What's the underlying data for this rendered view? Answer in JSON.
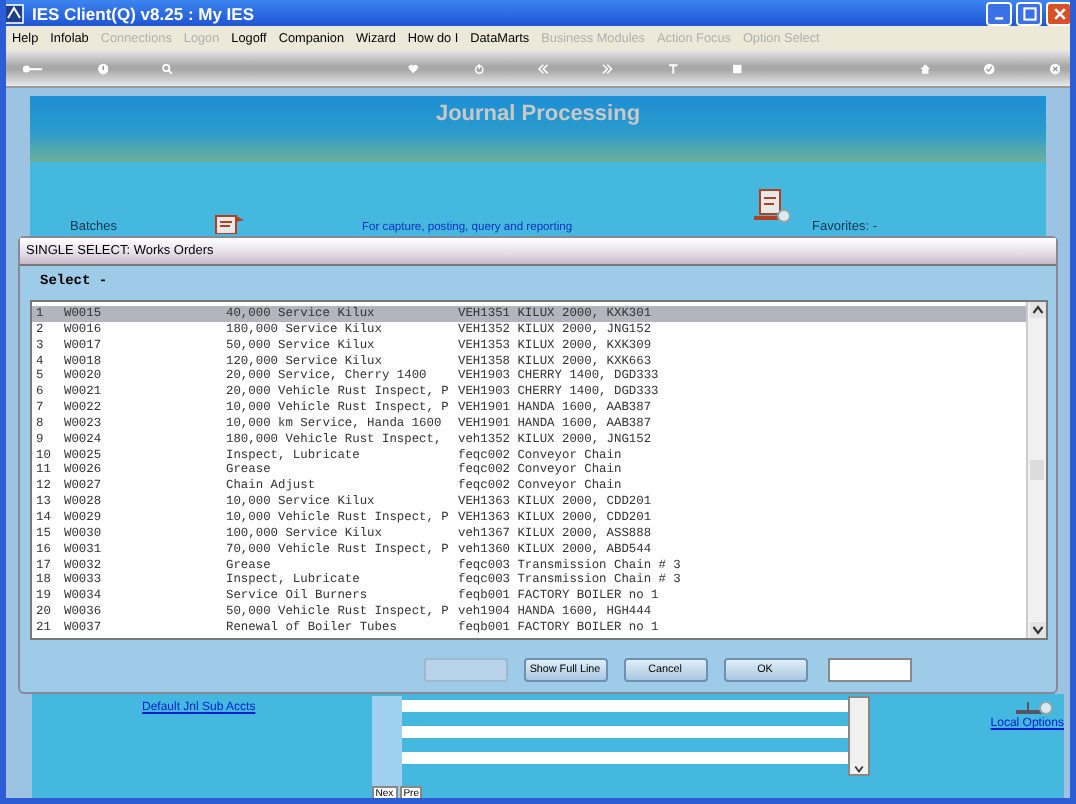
{
  "window": {
    "title": "IES Client(Q) v8.25 : My IES"
  },
  "menu": [
    {
      "label": "Help",
      "disabled": false
    },
    {
      "label": "Infolab",
      "disabled": false
    },
    {
      "label": "Connections",
      "disabled": true
    },
    {
      "label": "Logon",
      "disabled": true
    },
    {
      "label": "Logoff",
      "disabled": false
    },
    {
      "label": "Companion",
      "disabled": false
    },
    {
      "label": "Wizard",
      "disabled": false
    },
    {
      "label": "How do I",
      "disabled": false
    },
    {
      "label": "DataMarts",
      "disabled": false
    },
    {
      "label": "Business Modules",
      "disabled": true
    },
    {
      "label": "Action Focus",
      "disabled": true
    },
    {
      "label": "Option Select",
      "disabled": true
    }
  ],
  "header": {
    "title": "Journal Processing",
    "batches": "Batches",
    "subtitle": "For capture, posting, query and reporting",
    "favorites": "Favorites: -"
  },
  "dialog": {
    "title": "SINGLE SELECT: Works Orders",
    "select_label": "Select -",
    "rows": [
      {
        "number": "1",
        "code": "W0015",
        "description": "40,000 Service Kilux",
        "column_4": "VEH1351 KILUX 2000, KXK301",
        "selected": true
      },
      {
        "number": "2",
        "code": "W0016",
        "description": "180,000 Service Kilux",
        "column_4": "VEH1352 KILUX 2000, JNG152",
        "selected": false
      },
      {
        "number": "3",
        "code": "W0017",
        "description": "50,000 Service Kilux",
        "column_4": "VEH1353 KILUX 2000, KXK309",
        "selected": false
      },
      {
        "number": "4",
        "code": "W0018",
        "description": "120,000 Service Kilux",
        "column_4": "VEH1358 KILUX 2000, KXK663",
        "selected": false
      },
      {
        "number": "5",
        "code": "W0020",
        "description": "20,000 Service, Cherry 1400",
        "column_4": "VEH1903 CHERRY 1400, DGD333",
        "selected": false
      },
      {
        "number": "6",
        "code": "W0021",
        "description": "20,000 Vehicle Rust Inspect, P",
        "column_4": "VEH1903 CHERRY 1400, DGD333",
        "selected": false
      },
      {
        "number": "7",
        "code": "W0022",
        "description": "10,000 Vehicle Rust Inspect, P",
        "column_4": "VEH1901 HANDA 1600, AAB387",
        "selected": false
      },
      {
        "number": "8",
        "code": "W0023",
        "description": "10,000 km Service, Handa 1600",
        "column_4": "VEH1901 HANDA 1600, AAB387",
        "selected": false
      },
      {
        "number": "9",
        "code": "W0024",
        "description": "180,000 Vehicle Rust Inspect,",
        "column_4": "veh1352 KILUX 2000, JNG152",
        "selected": false
      },
      {
        "number": "10",
        "code": "W0025",
        "description": "Inspect, Lubricate",
        "column_4": "feqc002 Conveyor Chain",
        "selected": false
      },
      {
        "number": "11",
        "code": "W0026",
        "description": "Grease",
        "column_4": "feqc002 Conveyor Chain",
        "selected": false
      },
      {
        "number": "12",
        "code": "W0027",
        "description": "Chain Adjust",
        "column_4": "feqc002 Conveyor Chain",
        "selected": false
      },
      {
        "number": "13",
        "code": "W0028",
        "description": "10,000 Service Kilux",
        "column_4": "VEH1363 KILUX 2000, CDD201",
        "selected": false
      },
      {
        "number": "14",
        "code": "W0029",
        "description": "10,000 Vehicle Rust Inspect, P",
        "column_4": "VEH1363 KILUX 2000, CDD201",
        "selected": false
      },
      {
        "number": "15",
        "code": "W0030",
        "description": "100,000 Service Kilux",
        "column_4": "veh1367 KILUX 2000, ASS888",
        "selected": false
      },
      {
        "number": "16",
        "code": "W0031",
        "description": "70,000 Vehicle Rust Inspect, P",
        "column_4": "veh1360 KILUX 2000, ABD544",
        "selected": false
      },
      {
        "number": "17",
        "code": "W0032",
        "description": "Grease",
        "column_4": "feqc003 Transmission Chain # 3",
        "selected": false
      },
      {
        "number": "18",
        "code": "W0033",
        "description": "Inspect, Lubricate",
        "column_4": "feqc003 Transmission Chain # 3",
        "selected": false
      },
      {
        "number": "19",
        "code": "W0034",
        "description": "Service Oil Burners",
        "column_4": "feqb001 FACTORY BOILER no 1",
        "selected": false
      },
      {
        "number": "20",
        "code": "W0036",
        "description": "50,000 Vehicle Rust Inspect, P",
        "column_4": "veh1904 HANDA 1600, HGH444",
        "selected": false
      },
      {
        "number": "21",
        "code": "W0037",
        "description": "Renewal of Boiler Tubes",
        "column_4": "feqb001 FACTORY BOILER no 1",
        "selected": false
      }
    ],
    "buttons": [
      {
        "disabled": true
      },
      {
        "label": "Show Full Line",
        "disabled": false
      },
      {
        "label": "Cancel",
        "disabled": false
      },
      {
        "label": "OK",
        "disabled": false
      }
    ]
  },
  "bottom": {
    "link": "Default Jnl Sub Accts",
    "tabs": [
      {
        "label": "Nex"
      },
      {
        "label": "Pre"
      }
    ],
    "local_options": "Local Options"
  }
}
